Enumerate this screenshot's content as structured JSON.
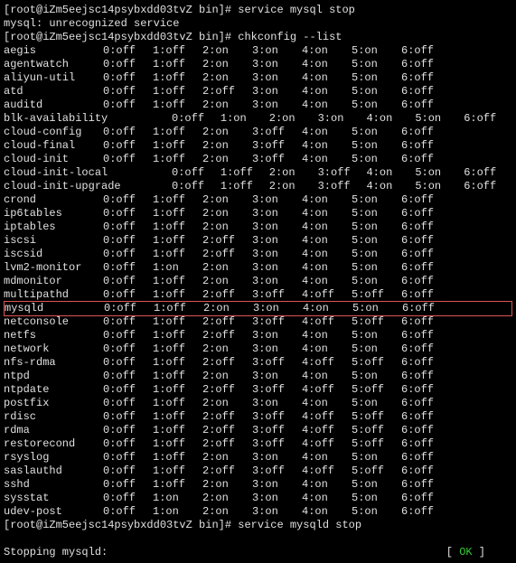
{
  "prompt1": "[root@iZm5eejsc14psybxdd03tvZ bin]# ",
  "cmd1": "service mysql stop",
  "err1": "mysql: unrecognized service",
  "prompt2": "[root@iZm5eejsc14psybxdd03tvZ bin]# ",
  "cmd2": "chkconfig --list",
  "services": [
    {
      "n": "aegis",
      "w": false,
      "l": [
        "0:off",
        "1:off",
        "2:on",
        "3:on",
        "4:on",
        "5:on",
        "6:off"
      ]
    },
    {
      "n": "agentwatch",
      "w": false,
      "l": [
        "0:off",
        "1:off",
        "2:on",
        "3:on",
        "4:on",
        "5:on",
        "6:off"
      ]
    },
    {
      "n": "aliyun-util",
      "w": false,
      "l": [
        "0:off",
        "1:off",
        "2:on",
        "3:on",
        "4:on",
        "5:on",
        "6:off"
      ]
    },
    {
      "n": "atd",
      "w": false,
      "l": [
        "0:off",
        "1:off",
        "2:off",
        "3:on",
        "4:on",
        "5:on",
        "6:off"
      ]
    },
    {
      "n": "auditd",
      "w": false,
      "l": [
        "0:off",
        "1:off",
        "2:on",
        "3:on",
        "4:on",
        "5:on",
        "6:off"
      ]
    },
    {
      "n": "blk-availability",
      "w": true,
      "l": [
        "0:off",
        "1:on",
        "2:on",
        "3:on",
        "4:on",
        "5:on",
        "6:off"
      ]
    },
    {
      "n": "cloud-config",
      "w": false,
      "l": [
        "0:off",
        "1:off",
        "2:on",
        "3:off",
        "4:on",
        "5:on",
        "6:off"
      ]
    },
    {
      "n": "cloud-final",
      "w": false,
      "l": [
        "0:off",
        "1:off",
        "2:on",
        "3:off",
        "4:on",
        "5:on",
        "6:off"
      ]
    },
    {
      "n": "cloud-init",
      "w": false,
      "l": [
        "0:off",
        "1:off",
        "2:on",
        "3:off",
        "4:on",
        "5:on",
        "6:off"
      ]
    },
    {
      "n": "cloud-init-local",
      "w": true,
      "l": [
        "0:off",
        "1:off",
        "2:on",
        "3:off",
        "4:on",
        "5:on",
        "6:off"
      ]
    },
    {
      "n": "cloud-init-upgrade",
      "w": true,
      "l": [
        "0:off",
        "1:off",
        "2:on",
        "3:off",
        "4:on",
        "5:on",
        "6:off"
      ]
    },
    {
      "n": "crond",
      "w": false,
      "l": [
        "0:off",
        "1:off",
        "2:on",
        "3:on",
        "4:on",
        "5:on",
        "6:off"
      ]
    },
    {
      "n": "ip6tables",
      "w": false,
      "l": [
        "0:off",
        "1:off",
        "2:on",
        "3:on",
        "4:on",
        "5:on",
        "6:off"
      ]
    },
    {
      "n": "iptables",
      "w": false,
      "l": [
        "0:off",
        "1:off",
        "2:on",
        "3:on",
        "4:on",
        "5:on",
        "6:off"
      ]
    },
    {
      "n": "iscsi",
      "w": false,
      "l": [
        "0:off",
        "1:off",
        "2:off",
        "3:on",
        "4:on",
        "5:on",
        "6:off"
      ]
    },
    {
      "n": "iscsid",
      "w": false,
      "l": [
        "0:off",
        "1:off",
        "2:off",
        "3:on",
        "4:on",
        "5:on",
        "6:off"
      ]
    },
    {
      "n": "lvm2-monitor",
      "w": false,
      "l": [
        "0:off",
        "1:on",
        "2:on",
        "3:on",
        "4:on",
        "5:on",
        "6:off"
      ]
    },
    {
      "n": "mdmonitor",
      "w": false,
      "l": [
        "0:off",
        "1:off",
        "2:on",
        "3:on",
        "4:on",
        "5:on",
        "6:off"
      ]
    },
    {
      "n": "multipathd",
      "w": false,
      "l": [
        "0:off",
        "1:off",
        "2:off",
        "3:off",
        "4:off",
        "5:off",
        "6:off"
      ]
    },
    {
      "n": "mysqld",
      "w": false,
      "hl": true,
      "l": [
        "0:off",
        "1:off",
        "2:on",
        "3:on",
        "4:on",
        "5:on",
        "6:off"
      ]
    },
    {
      "n": "netconsole",
      "w": false,
      "l": [
        "0:off",
        "1:off",
        "2:off",
        "3:off",
        "4:off",
        "5:off",
        "6:off"
      ]
    },
    {
      "n": "netfs",
      "w": false,
      "l": [
        "0:off",
        "1:off",
        "2:off",
        "3:on",
        "4:on",
        "5:on",
        "6:off"
      ]
    },
    {
      "n": "network",
      "w": false,
      "l": [
        "0:off",
        "1:off",
        "2:on",
        "3:on",
        "4:on",
        "5:on",
        "6:off"
      ]
    },
    {
      "n": "nfs-rdma",
      "w": false,
      "l": [
        "0:off",
        "1:off",
        "2:off",
        "3:off",
        "4:off",
        "5:off",
        "6:off"
      ]
    },
    {
      "n": "ntpd",
      "w": false,
      "l": [
        "0:off",
        "1:off",
        "2:on",
        "3:on",
        "4:on",
        "5:on",
        "6:off"
      ]
    },
    {
      "n": "ntpdate",
      "w": false,
      "l": [
        "0:off",
        "1:off",
        "2:off",
        "3:off",
        "4:off",
        "5:off",
        "6:off"
      ]
    },
    {
      "n": "postfix",
      "w": false,
      "l": [
        "0:off",
        "1:off",
        "2:on",
        "3:on",
        "4:on",
        "5:on",
        "6:off"
      ]
    },
    {
      "n": "rdisc",
      "w": false,
      "l": [
        "0:off",
        "1:off",
        "2:off",
        "3:off",
        "4:off",
        "5:off",
        "6:off"
      ]
    },
    {
      "n": "rdma",
      "w": false,
      "l": [
        "0:off",
        "1:off",
        "2:off",
        "3:off",
        "4:off",
        "5:off",
        "6:off"
      ]
    },
    {
      "n": "restorecond",
      "w": false,
      "l": [
        "0:off",
        "1:off",
        "2:off",
        "3:off",
        "4:off",
        "5:off",
        "6:off"
      ]
    },
    {
      "n": "rsyslog",
      "w": false,
      "l": [
        "0:off",
        "1:off",
        "2:on",
        "3:on",
        "4:on",
        "5:on",
        "6:off"
      ]
    },
    {
      "n": "saslauthd",
      "w": false,
      "l": [
        "0:off",
        "1:off",
        "2:off",
        "3:off",
        "4:off",
        "5:off",
        "6:off"
      ]
    },
    {
      "n": "sshd",
      "w": false,
      "l": [
        "0:off",
        "1:off",
        "2:on",
        "3:on",
        "4:on",
        "5:on",
        "6:off"
      ]
    },
    {
      "n": "sysstat",
      "w": false,
      "l": [
        "0:off",
        "1:on",
        "2:on",
        "3:on",
        "4:on",
        "5:on",
        "6:off"
      ]
    },
    {
      "n": "udev-post",
      "w": false,
      "l": [
        "0:off",
        "1:on",
        "2:on",
        "3:on",
        "4:on",
        "5:on",
        "6:off"
      ]
    }
  ],
  "prompt3": "[root@iZm5eejsc14psybxdd03tvZ bin]# ",
  "cmd3": "service mysqld stop",
  "stop_label": "Stopping mysqld:",
  "stop_lb": "[  ",
  "stop_ok": "OK",
  "stop_rb": "  ]"
}
